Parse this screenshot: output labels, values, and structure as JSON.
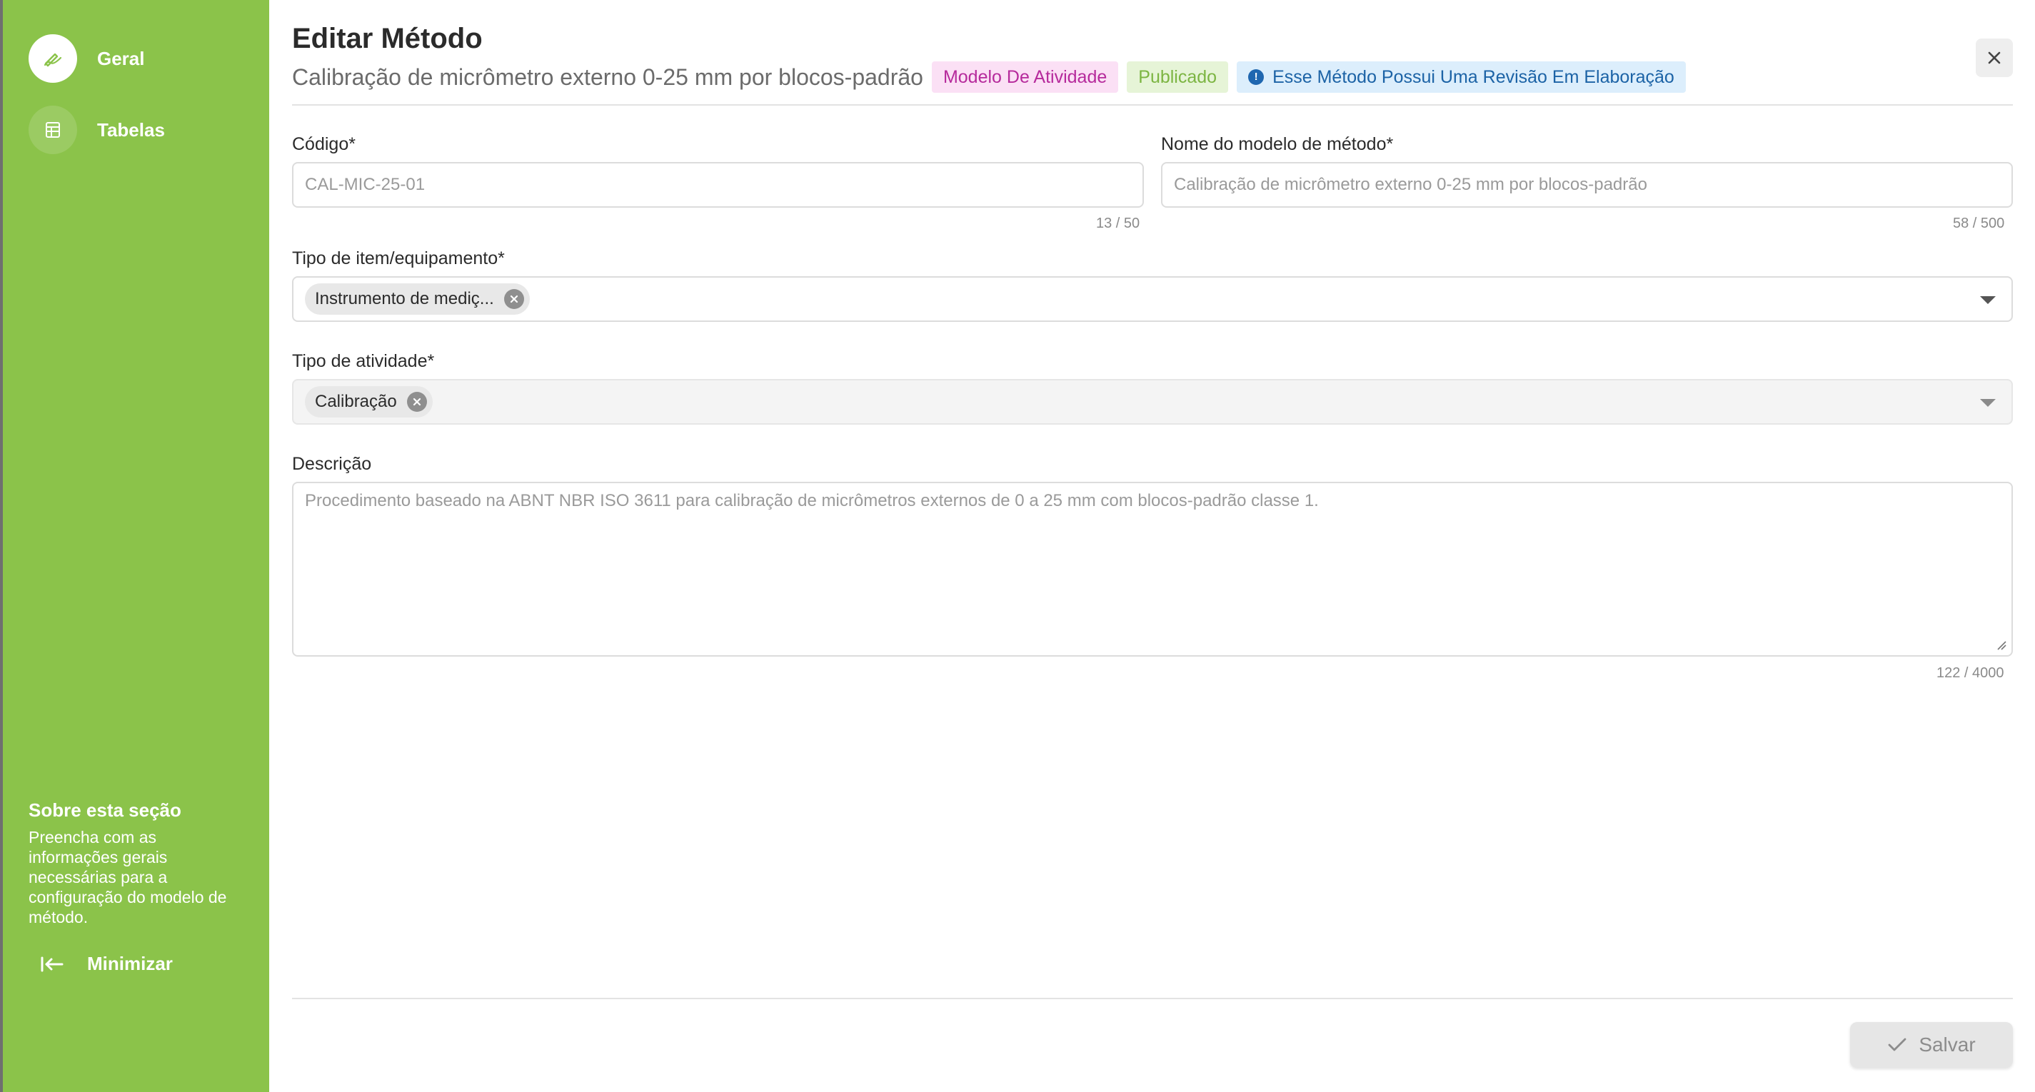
{
  "sidebar": {
    "nav": [
      {
        "label": "Geral",
        "icon": "pencil-icon",
        "active": true
      },
      {
        "label": "Tabelas",
        "icon": "table-icon",
        "active": false
      }
    ],
    "about_title": "Sobre esta seção",
    "about_text": "Preencha com as informações gerais necessárias para a configuração do modelo de método.",
    "minimize_label": "Minimizar",
    "color": "#8bc34a"
  },
  "header": {
    "title": "Editar Método",
    "subtitle": "Calibração de micrômetro externo 0-25 mm por blocos-padrão",
    "tags": {
      "model": "Modelo De Atividade",
      "published": "Publicado",
      "revision": "Esse Método Possui Uma Revisão Em Elaboração"
    },
    "close_icon": "close-icon"
  },
  "form": {
    "codigo": {
      "label": "Código*",
      "value": "CAL-MIC-25-01",
      "counter": "13 / 50"
    },
    "nome": {
      "label": "Nome do modelo de método*",
      "value": "Calibração de micrômetro externo 0-25 mm por blocos-padrão",
      "counter": "58 / 500"
    },
    "tipo_item": {
      "label": "Tipo de item/equipamento*",
      "chip": "Instrumento de mediç..."
    },
    "tipo_atividade": {
      "label": "Tipo de atividade*",
      "chip": "Calibração"
    },
    "descricao": {
      "label": "Descrição",
      "value": "Procedimento baseado na ABNT NBR ISO 3611 para calibração de micrômetros externos de 0 a 25 mm com blocos-padrão classe 1.",
      "counter": "122 / 4000"
    }
  },
  "footer": {
    "save_label": "Salvar"
  }
}
